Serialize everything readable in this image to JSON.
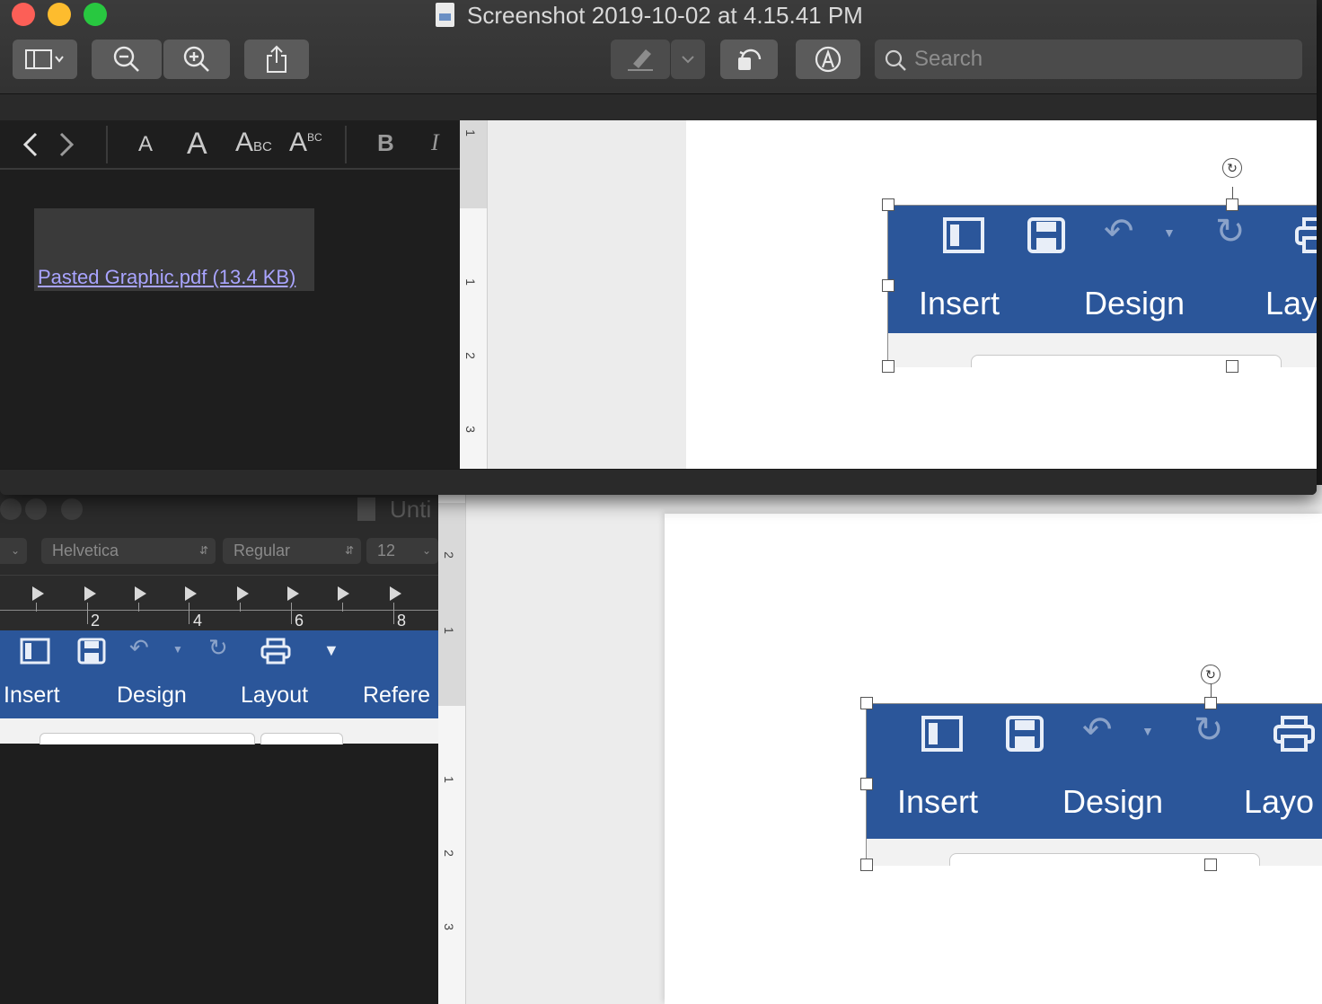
{
  "preview": {
    "title": "Screenshot 2019-10-02 at 4.15.41 PM",
    "search": {
      "placeholder": "Search"
    },
    "attachment": {
      "label": "Pasted Graphic.pdf (13.4 KB)"
    },
    "format": {
      "bold": "B",
      "italic": "I"
    },
    "ruler_numbers": [
      "1",
      "1",
      "2",
      "3"
    ],
    "pasted_tabs": [
      "Insert",
      "Design",
      "Lay"
    ]
  },
  "textedit": {
    "title": "Unti",
    "font_family": "Helvetica",
    "font_style": "Regular",
    "font_size": "12",
    "ruler_numbers": [
      "2",
      "4",
      "6",
      "8"
    ],
    "word_tabs": [
      "Insert",
      "Design",
      "Layout",
      "Refere"
    ],
    "v_ruler_numbers": [
      "2",
      "1",
      "1",
      "2",
      "3"
    ],
    "pasted_tabs": [
      "Insert",
      "Design",
      "Layo"
    ]
  },
  "colors": {
    "word_blue": "#2b569a",
    "close": "#fc5f57",
    "minimize": "#fdbc2e",
    "zoom": "#28c840",
    "link": "#a9a4ff"
  }
}
